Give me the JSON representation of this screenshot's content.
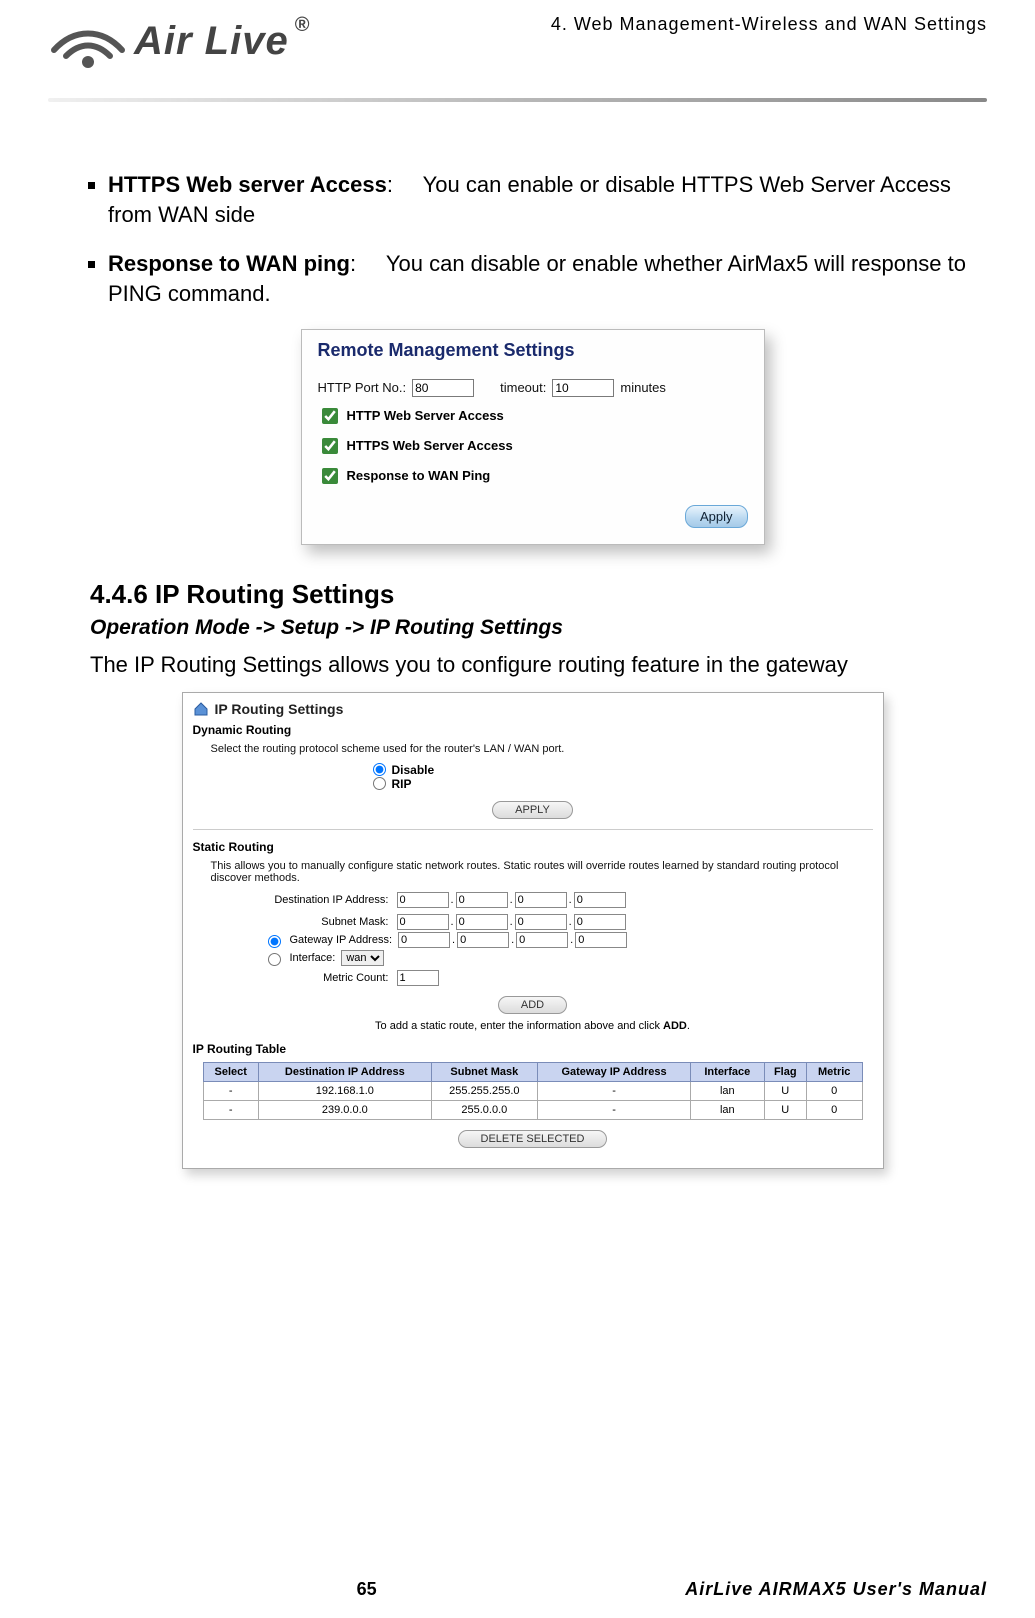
{
  "header": {
    "chapter": "4.  Web  Management-Wireless  and  WAN  Settings",
    "logo_text": "Air Live",
    "logo_tm": "®"
  },
  "bullets": [
    {
      "label": "HTTPS Web server Access",
      "desc": "You can enable or disable HTTPS Web Server Access from WAN side"
    },
    {
      "label": "Response to WAN ping",
      "desc": "You can disable or enable whether AirMax5 will response to PING command."
    }
  ],
  "fig1": {
    "title": "Remote Management Settings",
    "http_port_label": "HTTP Port No.:",
    "http_port_value": "80",
    "timeout_label": "timeout:",
    "timeout_value": "10",
    "timeout_suffix": "minutes",
    "checks": {
      "http": {
        "label": "HTTP Web Server Access",
        "checked": true
      },
      "https": {
        "label": "HTTPS Web Server Access",
        "checked": true
      },
      "ping": {
        "label": "Response to WAN Ping",
        "checked": true
      }
    },
    "apply_label": "Apply"
  },
  "section": {
    "number": "4.4.6 IP Routing Settings",
    "path": "Operation Mode -> Setup -> IP Routing Settings",
    "intro": "The IP Routing Settings allows you to configure routing feature in the gateway"
  },
  "fig2": {
    "title": "IP Routing Settings",
    "dynamic": {
      "hdr": "Dynamic Routing",
      "help": "Select the routing protocol scheme used for the router's LAN / WAN port.",
      "disable_label": "Disable",
      "rip_label": "RIP",
      "selected": "disable",
      "apply_label": "APPLY"
    },
    "static": {
      "hdr": "Static Routing",
      "help": "This allows you to manually configure static network routes. Static routes will override routes learned by standard routing protocol discover methods.",
      "dest_label": "Destination IP Address:",
      "dest": [
        "0",
        "0",
        "0",
        "0"
      ],
      "mask_label": "Subnet Mask:",
      "mask": [
        "0",
        "0",
        "0",
        "0"
      ],
      "gw_label": "Gateway IP Address:",
      "gw": [
        "0",
        "0",
        "0",
        "0"
      ],
      "iface_label": "Interface:",
      "iface_options": [
        "wan"
      ],
      "iface_selected": "wan",
      "metric_label": "Metric Count:",
      "metric_value": "1",
      "route_toggle": "gateway",
      "add_label": "ADD",
      "add_help_prefix": "To add a static route, enter the information above and click ",
      "add_help_bold": "ADD",
      "add_help_suffix": "."
    },
    "table": {
      "hdr": "IP Routing Table",
      "cols": [
        "Select",
        "Destination IP Address",
        "Subnet Mask",
        "Gateway IP Address",
        "Interface",
        "Flag",
        "Metric"
      ],
      "rows": [
        [
          "-",
          "192.168.1.0",
          "255.255.255.0",
          "-",
          "lan",
          "U",
          "0"
        ],
        [
          "-",
          "239.0.0.0",
          "255.0.0.0",
          "-",
          "lan",
          "U",
          "0"
        ]
      ],
      "delete_label": "DELETE SELECTED"
    }
  },
  "footer": {
    "page_no": "65",
    "manual": "AirLive  AIRMAX5  User's  Manual"
  }
}
